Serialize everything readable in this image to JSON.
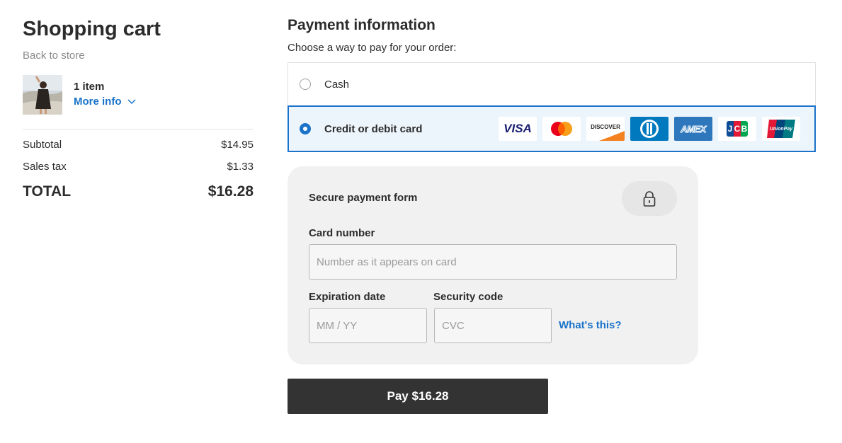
{
  "cart": {
    "title": "Shopping cart",
    "back_link": "Back to store",
    "item_count": "1 item",
    "more_info": "More info",
    "subtotal_label": "Subtotal",
    "subtotal_value": "$14.95",
    "tax_label": "Sales tax",
    "tax_value": "$1.33",
    "total_label": "TOTAL",
    "total_value": "$16.28"
  },
  "payment": {
    "title": "Payment information",
    "subtitle": "Choose a way to pay for your order:",
    "options": [
      {
        "label": "Cash",
        "selected": false
      },
      {
        "label": "Credit or debit card",
        "selected": true
      }
    ],
    "card_logos": {
      "visa": "VISA",
      "discover": "DISCOVER",
      "amex": "AMEX",
      "jcb": "JCB",
      "unionpay": "UnionPay"
    }
  },
  "secure_form": {
    "title": "Secure payment form",
    "card_number_label": "Card number",
    "card_number_placeholder": "Number as it appears on card",
    "card_number_value": "",
    "expiration_label": "Expiration date",
    "expiration_placeholder": "MM / YY",
    "expiration_value": "",
    "security_label": "Security code",
    "security_placeholder": "CVC",
    "security_value": "",
    "whats_this": "What's this?"
  },
  "pay_button": "Pay $16.28",
  "colors": {
    "accent": "#1a73c9",
    "selected_bg": "#edf5fc",
    "button_bg": "#333333",
    "form_bg": "#f1f1f1"
  },
  "icons": [
    "chevron-down-icon",
    "lock-icon",
    "product-thumbnail"
  ]
}
